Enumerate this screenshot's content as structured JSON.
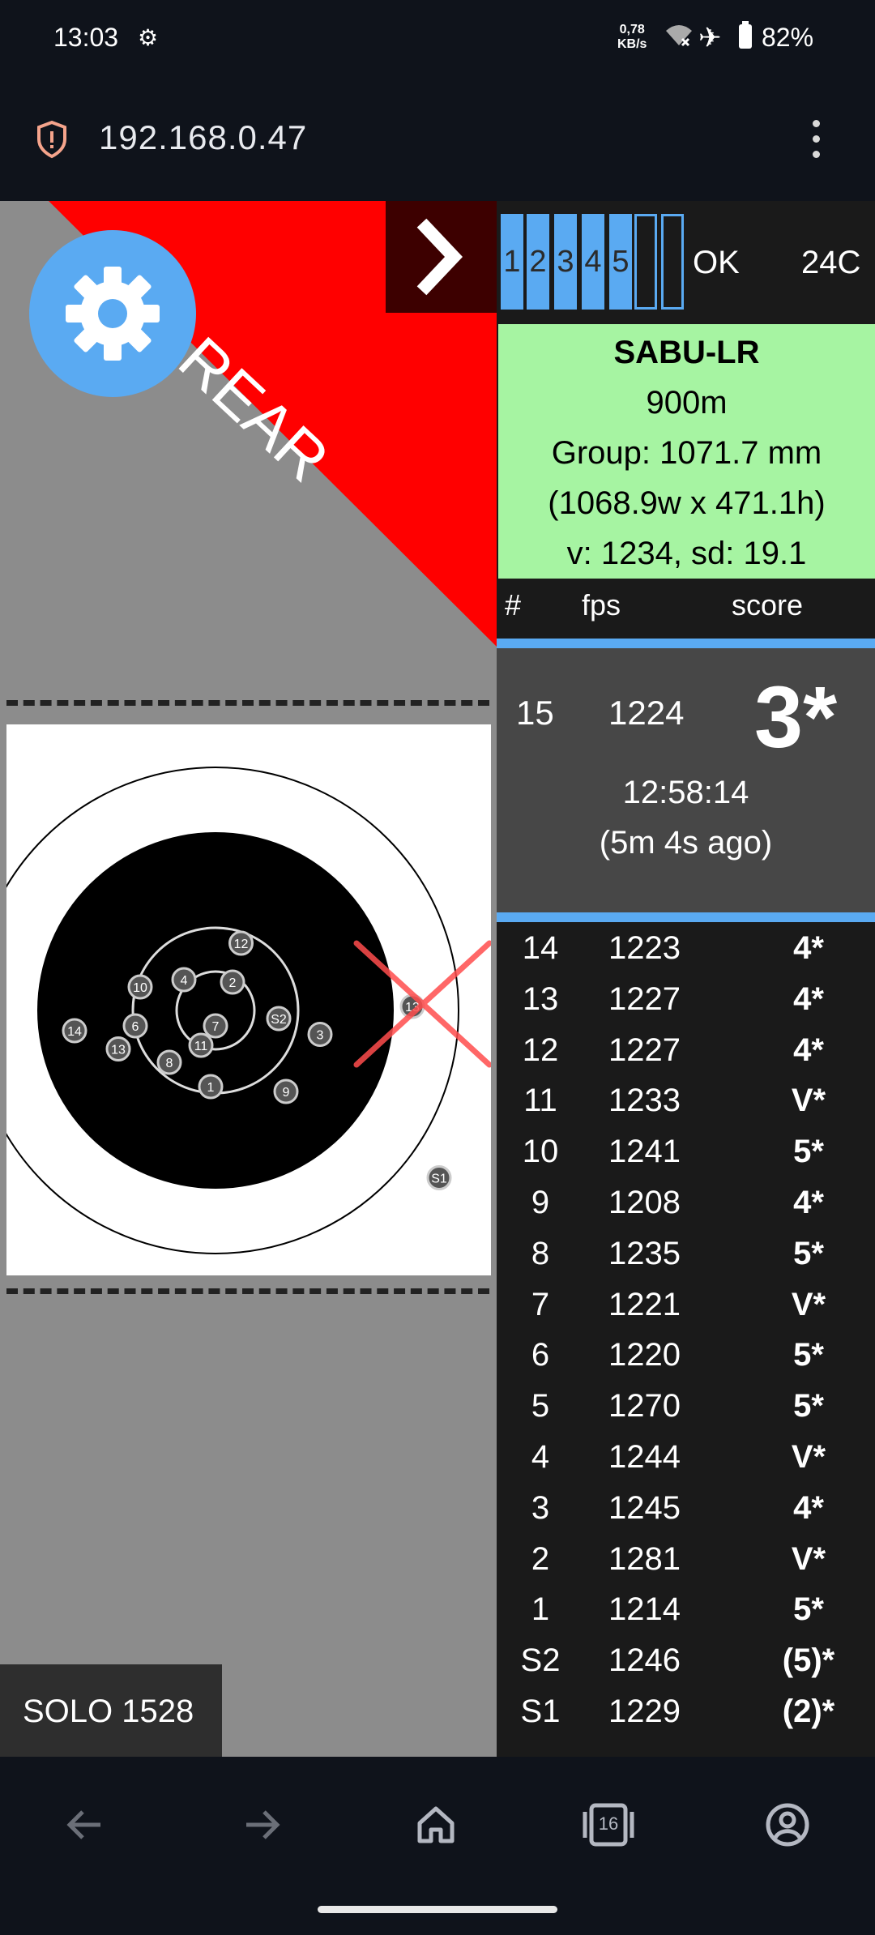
{
  "status_bar": {
    "time": "13:03",
    "net_speed_value": "0,78",
    "net_speed_unit": "KB/s",
    "battery": "82%"
  },
  "browser": {
    "url": "192.168.0.47",
    "tab_count": "16"
  },
  "target_panel": {
    "rear_label": "REAR",
    "solo_label": "SOLO 1528",
    "shot_marks": [
      "12",
      "10",
      "4",
      "2",
      "6",
      "11",
      "7",
      "S2",
      "3",
      "14",
      "13",
      "8",
      "1",
      "9",
      "13",
      "S1"
    ]
  },
  "shot_indicator": {
    "cells": [
      "1",
      "2",
      "3",
      "4",
      "5",
      "",
      ""
    ],
    "status": "OK",
    "temperature": "24C"
  },
  "summary": {
    "name": "SABU-LR",
    "distance": "900m",
    "group": "Group: 1071.7 mm",
    "dimensions": "(1068.9w x 471.1h)",
    "velocity": "v: 1234, sd: 19.1"
  },
  "table_header": {
    "num": "#",
    "fps": "fps",
    "score": "score"
  },
  "latest_shot": {
    "num": "15",
    "fps": "1224",
    "score": "3*",
    "time": "12:58:14",
    "ago": "(5m 4s ago)"
  },
  "shots": [
    {
      "num": "14",
      "fps": "1223",
      "score": "4*"
    },
    {
      "num": "13",
      "fps": "1227",
      "score": "4*"
    },
    {
      "num": "12",
      "fps": "1227",
      "score": "4*"
    },
    {
      "num": "11",
      "fps": "1233",
      "score": "V*"
    },
    {
      "num": "10",
      "fps": "1241",
      "score": "5*"
    },
    {
      "num": "9",
      "fps": "1208",
      "score": "4*"
    },
    {
      "num": "8",
      "fps": "1235",
      "score": "5*"
    },
    {
      "num": "7",
      "fps": "1221",
      "score": "V*"
    },
    {
      "num": "6",
      "fps": "1220",
      "score": "5*"
    },
    {
      "num": "5",
      "fps": "1270",
      "score": "5*"
    },
    {
      "num": "4",
      "fps": "1244",
      "score": "V*"
    },
    {
      "num": "3",
      "fps": "1245",
      "score": "4*"
    },
    {
      "num": "2",
      "fps": "1281",
      "score": "V*"
    },
    {
      "num": "1",
      "fps": "1214",
      "score": "5*"
    },
    {
      "num": "S2",
      "fps": "1246",
      "score": "(5)*"
    },
    {
      "num": "S1",
      "fps": "1229",
      "score": "(2)*"
    }
  ],
  "colors": {
    "accent": "#5aaaf2",
    "summary_bg": "#a6f4a2",
    "rear_red": "#ff0000",
    "miss_marker": "#ff4d4d"
  }
}
